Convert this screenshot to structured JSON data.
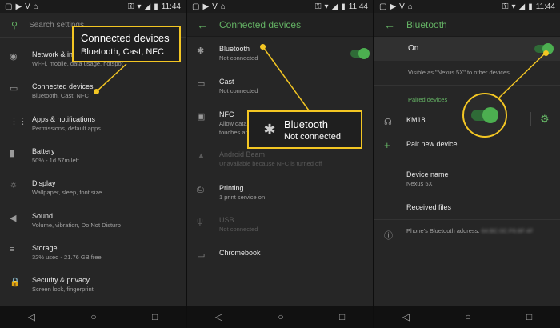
{
  "status": {
    "time": "11:44",
    "left_icons": [
      "▢",
      "▶",
      "V",
      "⌂"
    ],
    "right_icons": [
      "⚿",
      "▾",
      "◢",
      "▮"
    ]
  },
  "p1": {
    "search_placeholder": "Search settings",
    "items": [
      {
        "icon": "◉",
        "title": "Network & internet",
        "sub": "Wi-Fi, mobile, data usage, hotspot",
        "name": "network-icon"
      },
      {
        "icon": "▭",
        "title": "Connected devices",
        "sub": "Bluetooth, Cast, NFC",
        "name": "devices-icon"
      },
      {
        "icon": "⋮⋮",
        "title": "Apps & notifications",
        "sub": "Permissions, default apps",
        "name": "apps-icon"
      },
      {
        "icon": "▮",
        "title": "Battery",
        "sub": "50% - 1d 57m left",
        "name": "battery-icon"
      },
      {
        "icon": "☼",
        "title": "Display",
        "sub": "Wallpaper, sleep, font size",
        "name": "display-icon"
      },
      {
        "icon": "◀",
        "title": "Sound",
        "sub": "Volume, vibration, Do Not Disturb",
        "name": "sound-icon"
      },
      {
        "icon": "≡",
        "title": "Storage",
        "sub": "32% used - 21.76 GB free",
        "name": "storage-icon"
      },
      {
        "icon": "🔒",
        "title": "Security & privacy",
        "sub": "Screen lock, fingerprint",
        "name": "lock-icon"
      }
    ],
    "callout_title": "Connected devices",
    "callout_sub": "Bluetooth, Cast, NFC"
  },
  "p2": {
    "title": "Connected devices",
    "items": [
      {
        "icon": "✱",
        "title": "Bluetooth",
        "sub": "Not connected",
        "name": "bluetooth-icon",
        "dim": false
      },
      {
        "icon": "▭",
        "title": "Cast",
        "sub": "Not connected",
        "name": "cast-icon",
        "dim": false
      },
      {
        "icon": "▣",
        "title": "NFC",
        "sub": "Allow data exchange when the phone touches another device",
        "name": "nfc-icon",
        "dim": false
      },
      {
        "icon": "▲",
        "title": "Android Beam",
        "sub": "Unavailable because NFC is turned off",
        "name": "beam-icon",
        "dim": true
      },
      {
        "icon": "⎙",
        "title": "Printing",
        "sub": "1 print service on",
        "name": "print-icon",
        "dim": false
      },
      {
        "icon": "ψ",
        "title": "USB",
        "sub": "Not connected",
        "name": "usb-icon",
        "dim": true
      },
      {
        "icon": "▭",
        "title": "Chromebook",
        "sub": "",
        "name": "chromebook-icon",
        "dim": false
      }
    ],
    "callout_title": "Bluetooth",
    "callout_sub": "Not connected",
    "callout_icon": "✱"
  },
  "p3": {
    "title": "Bluetooth",
    "on_label": "On",
    "visible_text": "Visible as \"Nexus 5X\" to other devices",
    "paired_label": "Paired devices",
    "paired_device": "KM18",
    "pair_new": "Pair new device",
    "device_name_label": "Device name",
    "device_name_value": "Nexus 5X",
    "received_files": "Received files",
    "address_label": "Phone's Bluetooth address:",
    "address_value": "64:BC:0C:F6:8F:4F"
  },
  "colors": {
    "accent": "#64b264",
    "callout": "#f3c623"
  }
}
